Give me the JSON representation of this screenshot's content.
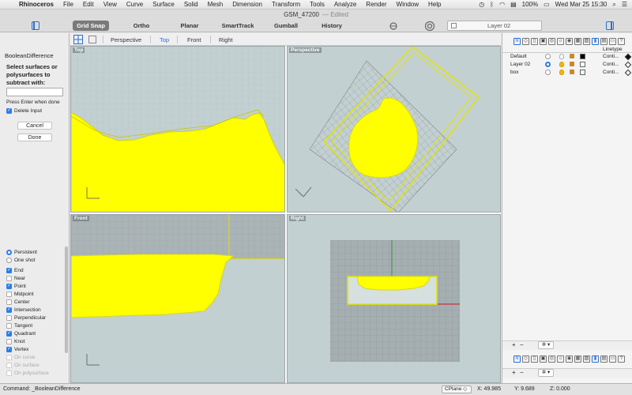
{
  "menubar": {
    "app_name": "Rhinoceros",
    "items": [
      "File",
      "Edit",
      "View",
      "Curve",
      "Surface",
      "Solid",
      "Mesh",
      "Dimension",
      "Transform",
      "Tools",
      "Analyze",
      "Render",
      "Window",
      "Help"
    ],
    "battery": "100%",
    "clock": "Wed Mar 25  15:30"
  },
  "window": {
    "title": "GSM_47200",
    "status": "— Edited"
  },
  "toolbar": {
    "buttons": [
      "Grid Snap",
      "Ortho",
      "Planar",
      "SmartTrack",
      "Gumball",
      "History"
    ],
    "active": "Grid Snap",
    "layer": "Layer 02"
  },
  "command_panel": {
    "title": "BooleanDifference",
    "prompt": "Select surfaces or polysurfaces to subtract with:",
    "hint": "Press Enter when done",
    "delete_input_label": "Delete Input",
    "delete_input_checked": true,
    "cancel_label": "Cancel",
    "done_label": "Done"
  },
  "osnap": {
    "modes": [
      {
        "label": "Persistent",
        "kind": "radio",
        "checked": true
      },
      {
        "label": "One shot",
        "kind": "radio",
        "checked": false
      }
    ],
    "items": [
      {
        "label": "End",
        "checked": true,
        "enabled": true
      },
      {
        "label": "Near",
        "checked": false,
        "enabled": true
      },
      {
        "label": "Point",
        "checked": true,
        "enabled": true
      },
      {
        "label": "Midpoint",
        "checked": false,
        "enabled": true
      },
      {
        "label": "Center",
        "checked": false,
        "enabled": true
      },
      {
        "label": "Intersection",
        "checked": true,
        "enabled": true
      },
      {
        "label": "Perpendicular",
        "checked": false,
        "enabled": true
      },
      {
        "label": "Tangent",
        "checked": false,
        "enabled": true
      },
      {
        "label": "Quadrant",
        "checked": true,
        "enabled": true
      },
      {
        "label": "Knot",
        "checked": false,
        "enabled": true
      },
      {
        "label": "Vertex",
        "checked": true,
        "enabled": true
      },
      {
        "label": "On curve",
        "checked": false,
        "enabled": false
      },
      {
        "label": "On surface",
        "checked": false,
        "enabled": false
      },
      {
        "label": "On polysurface",
        "checked": false,
        "enabled": false
      }
    ]
  },
  "viewport_tabs": {
    "tabs": [
      "Perspective",
      "Top",
      "Front",
      "Right"
    ],
    "active": "Top"
  },
  "viewports": {
    "top": "Top",
    "perspective": "Perspective",
    "front": "Front",
    "right": "Right"
  },
  "layers": {
    "columns": {
      "linetype": "Linetype"
    },
    "rows": [
      {
        "name": "Default",
        "current": false,
        "light": "off",
        "color": "#000000",
        "linetype": "Conti...",
        "diamond_filled": true
      },
      {
        "name": "Layer 02",
        "current": true,
        "light": "on",
        "color": "#ffffff",
        "linetype": "Conti...",
        "diamond_filled": false
      },
      {
        "name": "box",
        "current": false,
        "light": "on",
        "color": "#eaf6f6",
        "linetype": "Conti...",
        "diamond_filled": false
      }
    ]
  },
  "status": {
    "command": "Command: _BooleanDifference",
    "cplane": "CPlane",
    "x": "X: 49.985",
    "y": "Y: 9.689",
    "z": "Z: 0.000"
  },
  "colors": {
    "selection_yellow": "#ffff00",
    "selection_edge": "#d8d81a",
    "viewport_bg": "#c3d0d2",
    "accent_blue": "#2a6fd6"
  }
}
